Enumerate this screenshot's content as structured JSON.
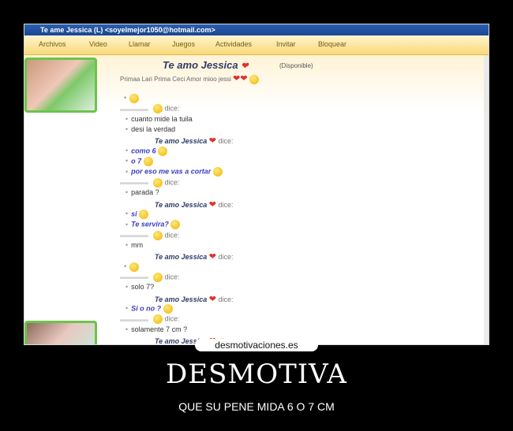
{
  "window": {
    "title": "Te ame Jessica (L) <soyelmejor1050@hotmail.com>"
  },
  "menu": [
    "Archivos",
    "Video",
    "Llamar",
    "Juegos",
    "Actividades",
    "Invitar",
    "Bloquear"
  ],
  "contact": {
    "name": "Te amo Jessica",
    "status": "(Disponible)",
    "sub": "Primaa Lari  Prima Ceci  Amor mioo jessi"
  },
  "chat": [
    {
      "type": "emoticon"
    },
    {
      "type": "speaker_other",
      "label": "dice:"
    },
    {
      "type": "msg",
      "text": "cuanto mide la tuila"
    },
    {
      "type": "msg",
      "text": "desi la verdad"
    },
    {
      "type": "speaker_me",
      "name": "Te amo Jessica",
      "label": "dice:"
    },
    {
      "type": "me",
      "text": "como 6"
    },
    {
      "type": "me",
      "text": "o 7"
    },
    {
      "type": "me",
      "text": "por eso me vas a cortar"
    },
    {
      "type": "speaker_other",
      "label": "dice:"
    },
    {
      "type": "msg",
      "text": "parada ?"
    },
    {
      "type": "speaker_me",
      "name": "Te amo Jessica",
      "label": "dice:"
    },
    {
      "type": "me",
      "text": "si"
    },
    {
      "type": "me",
      "text": "Te servira?"
    },
    {
      "type": "speaker_other",
      "label": "dice:"
    },
    {
      "type": "msg",
      "text": "mm"
    },
    {
      "type": "speaker_me",
      "name": "Te amo Jessica",
      "label": "dice:"
    },
    {
      "type": "emoticon"
    },
    {
      "type": "speaker_other",
      "label": "dice:"
    },
    {
      "type": "msg",
      "text": "solo 7?"
    },
    {
      "type": "speaker_me",
      "name": "Te amo Jessica",
      "label": "dice:"
    },
    {
      "type": "me",
      "text": "Si o no ?"
    },
    {
      "type": "speaker_other",
      "label": "dice:"
    },
    {
      "type": "msg",
      "text": "solamente 7 cm ?"
    },
    {
      "type": "speaker_me",
      "name": "Te amo Jessica",
      "label": "dice:"
    }
  ],
  "watermark": "desmotivaciones.es",
  "caption": {
    "title": "DESMOTIVA",
    "subtitle": "QUE SU PENE MIDA 6 O 7 CM"
  }
}
